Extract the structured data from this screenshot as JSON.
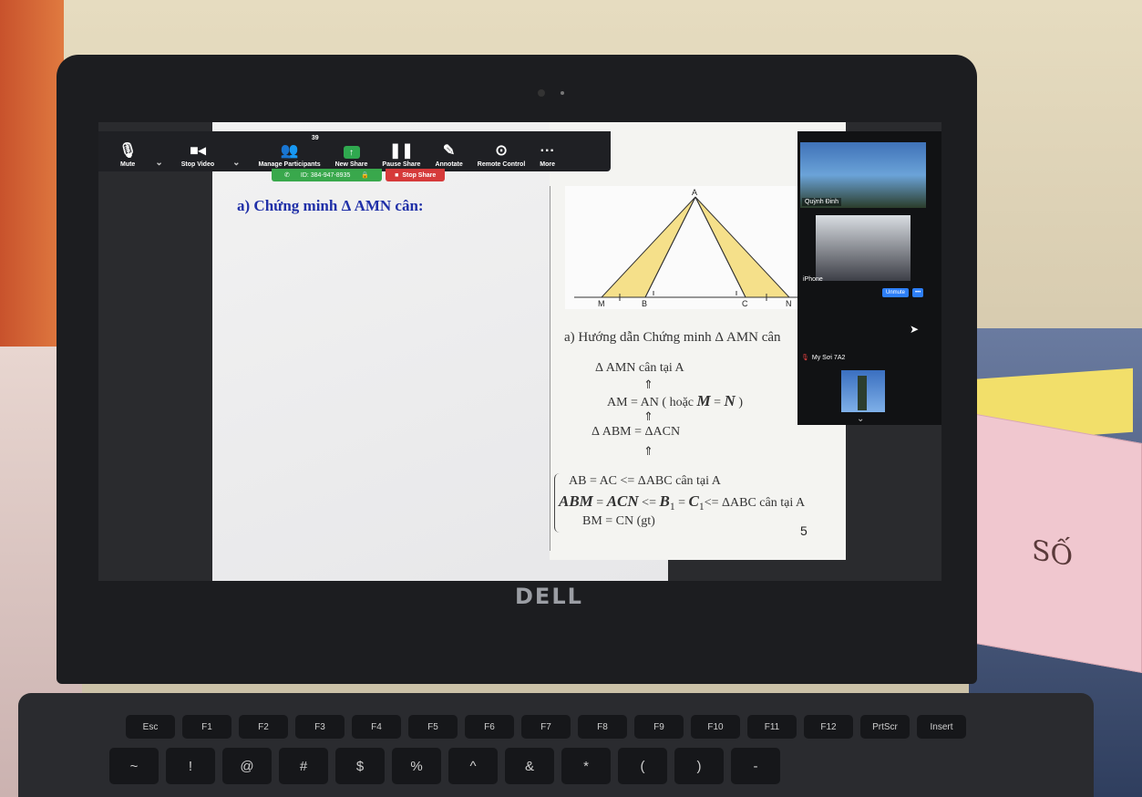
{
  "toolbar": {
    "mute_label": "Mute",
    "stop_video_label": "Stop Video",
    "participants_label": "Manage Participants",
    "participant_count": "39",
    "new_share_label": "New Share",
    "pause_share_label": "Pause Share",
    "annotate_label": "Annotate",
    "remote_control_label": "Remote Control",
    "more_label": "More"
  },
  "meeting": {
    "id_label": "ID: 384-947-8935",
    "stop_share_label": "Stop Share"
  },
  "slide": {
    "title": "a) Chứng minh Δ AMN cân:",
    "hint_title": "a) Hướng dẫn Chứng minh Δ AMN cân",
    "line1": "Δ AMN cân tại A",
    "line2a": "AM = AN  ( hoặc ",
    "line2b": "M",
    "line2c": " = ",
    "line2d": "N",
    "line2e": " )",
    "line3": "Δ ABM = ΔACN",
    "line4": "AB = AC <= ΔABC cân tại A",
    "line5a": "ABM",
    "line5b": " = ",
    "line5c": "ACN",
    "line5d": "  <= ",
    "line5e": "B",
    "line5f": "1",
    "line5g": " = ",
    "line5h": "C",
    "line5i": "1",
    "line5j": "<= ΔABC cân tại A",
    "line6": "BM = CN (gt)",
    "page_number": "5",
    "figure_labels": {
      "a": "A",
      "m": "M",
      "b": "B",
      "c": "C",
      "n": "N"
    }
  },
  "participants": [
    {
      "name": "Quỳnh Đinh"
    },
    {
      "name": "iPhone"
    },
    {
      "name": "My Sơi 7A2"
    }
  ],
  "panel": {
    "unmute_label": "Unmute",
    "more_label": "•••"
  },
  "hardware": {
    "brand": "DELL",
    "book_text": "SỐ"
  },
  "keys": {
    "fn_row": [
      "Esc",
      "F1",
      "F2",
      "F3",
      "F4",
      "F5",
      "F6",
      "F7",
      "F8",
      "F9",
      "F10",
      "F11",
      "F12",
      "PrtScr",
      "Insert"
    ],
    "num_row": [
      "~",
      "!",
      "@",
      "#",
      "$",
      "%",
      "^",
      "&",
      "*",
      "(",
      ")",
      "-"
    ]
  },
  "colors": {
    "slide_title": "#2030a8",
    "toolbar_bg": "#1f2024",
    "meeting_id_bg": "#39a84c",
    "stop_share_bg": "#d63a3a",
    "unmute_bg": "#2d7ff9",
    "figure_fill": "#f5e08a"
  }
}
